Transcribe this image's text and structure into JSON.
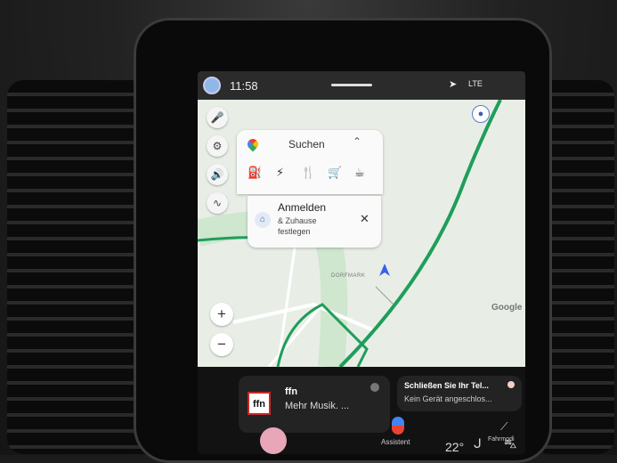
{
  "status_bar": {
    "time": "11:58",
    "network": "LTE"
  },
  "search": {
    "label": "Suchen",
    "categories": [
      {
        "icon": "gas-station-icon",
        "glyph": "⛽"
      },
      {
        "icon": "charging-icon",
        "glyph": "⚡"
      },
      {
        "icon": "restaurant-icon",
        "glyph": "🍴"
      },
      {
        "icon": "shopping-cart-icon",
        "glyph": "🛒"
      },
      {
        "icon": "coffee-icon",
        "glyph": "☕"
      }
    ]
  },
  "signin": {
    "title": "Anmelden",
    "subtitle": "& Zuhause festlegen"
  },
  "map": {
    "place": "DORFMARK",
    "attribution": "Google"
  },
  "media": {
    "station": "ffn",
    "subtitle": "Mehr Musik. ..."
  },
  "notification": {
    "title": "Schließen Sie Ihr Tel...",
    "subtitle": "Kein Gerät angeschlos..."
  },
  "assistant": {
    "label": "Assistent"
  },
  "drive": {
    "label": "Fahrmodi"
  },
  "climate": {
    "temperature": "22°"
  },
  "colors": {
    "route": "#1e9e5a",
    "map_bg": "#e8eee6",
    "accent_blue": "#4285f4"
  }
}
